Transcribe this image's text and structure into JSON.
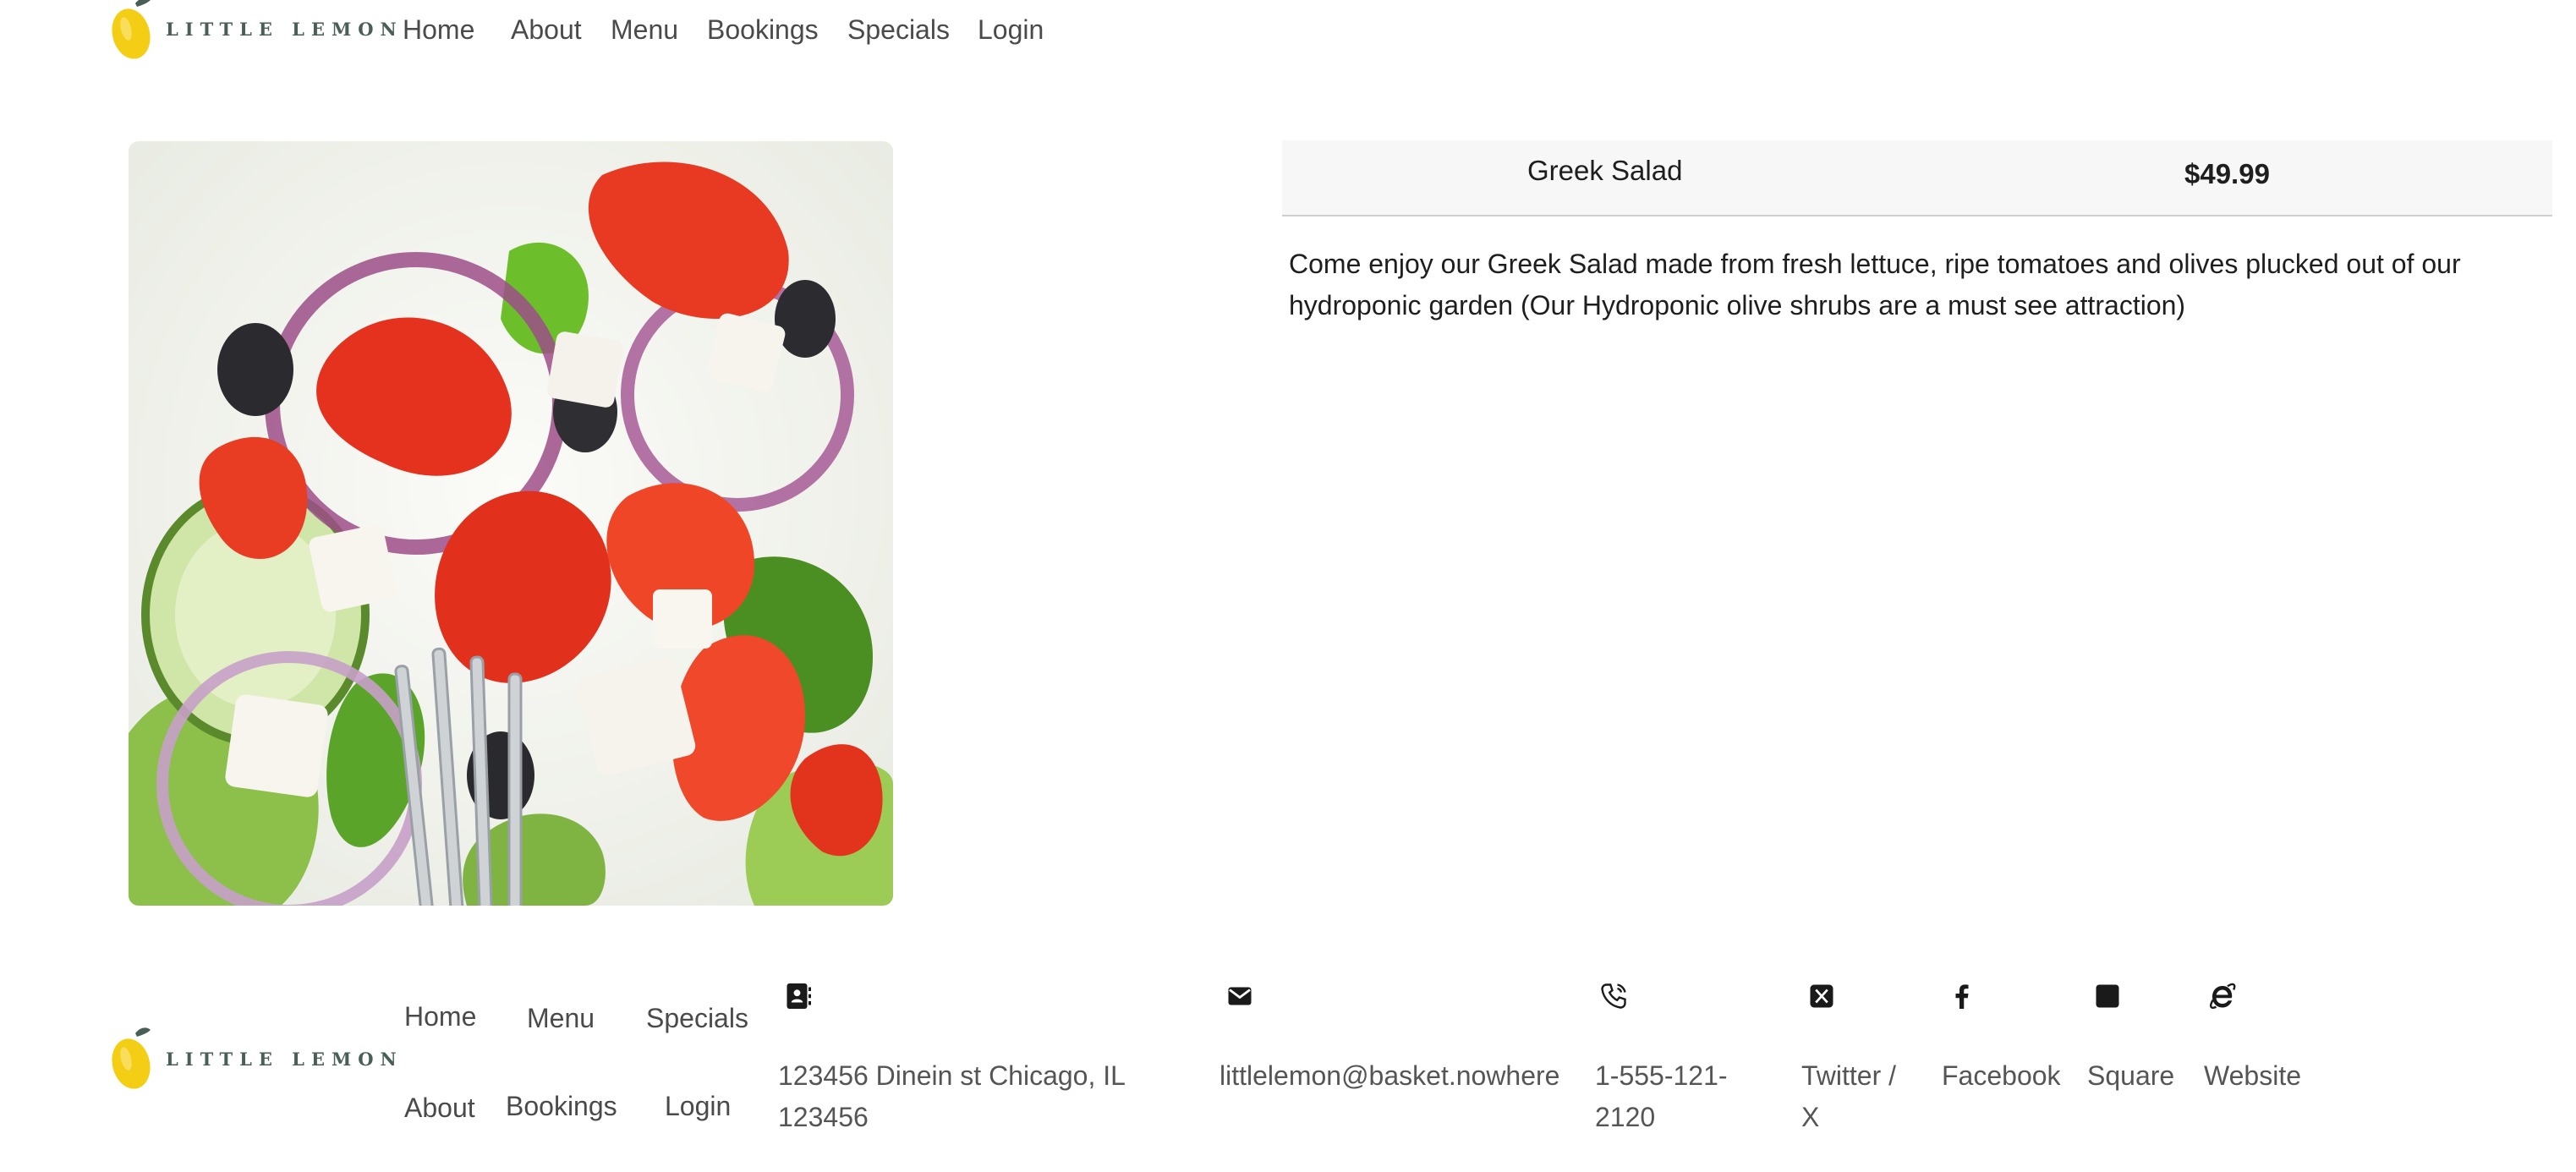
{
  "brand": {
    "name": "LITTLE LEMON",
    "logo_icon": "lemon-icon"
  },
  "nav": {
    "items": [
      {
        "label": "Home"
      },
      {
        "label": "About"
      },
      {
        "label": "Menu"
      },
      {
        "label": "Bookings"
      },
      {
        "label": "Specials"
      },
      {
        "label": "Login"
      }
    ]
  },
  "dish": {
    "name": "Greek Salad",
    "price": "$49.99",
    "description": "Come enjoy our Greek Salad made from fresh lettuce, ripe tomatoes and olives plucked out of our hydroponic garden (Our Hydroponic olive shrubs are a must see attraction)",
    "image": "greek-salad-photo"
  },
  "footer": {
    "nav": {
      "home": "Home",
      "menu": "Menu",
      "specials": "Specials",
      "about": "About",
      "bookings": "Bookings",
      "login": "Login"
    },
    "contact": {
      "address": "123456 Dinein st Chicago, IL 123456",
      "email": "littlelemon@basket.nowhere",
      "phone": "1-555-121-2120"
    },
    "social": {
      "twitter": "Twitter / X",
      "facebook": "Facebook",
      "square": "Square",
      "website": "Website"
    }
  },
  "colors": {
    "brand_green": "#495e57",
    "brand_yellow": "#f4ce14"
  }
}
